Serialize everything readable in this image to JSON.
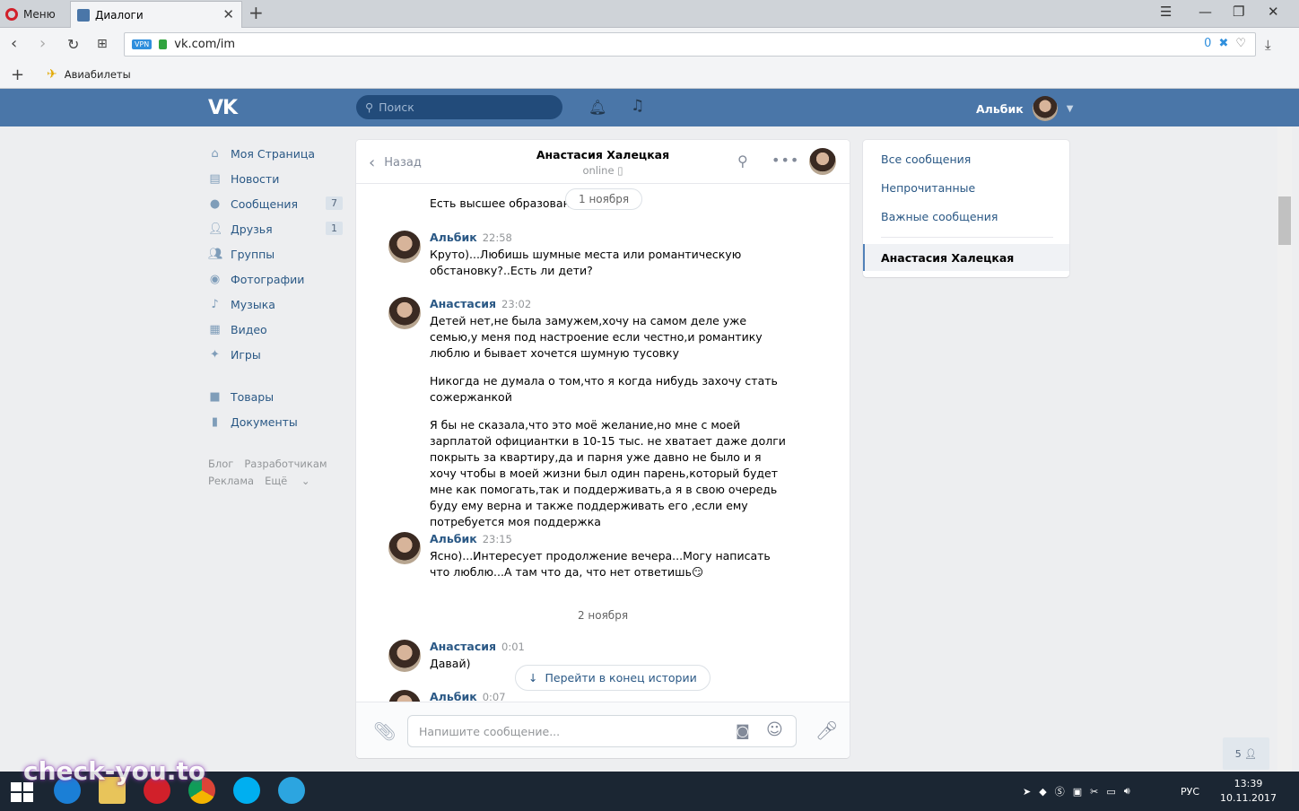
{
  "browser": {
    "menu_label": "Меню",
    "tab_title": "Диалоги",
    "url": "vk.com/im",
    "vpn_label": "VPN",
    "url_badge_count": "0",
    "bookmark_label": "Авиабилеты"
  },
  "header": {
    "logo": "VK",
    "search_placeholder": "Поиск",
    "user_name": "Альбик"
  },
  "left_menu": {
    "items": [
      {
        "label": "Моя Страница",
        "icon": "home-icon"
      },
      {
        "label": "Новости",
        "icon": "news-icon"
      },
      {
        "label": "Сообщения",
        "icon": "messages-icon",
        "count": "7"
      },
      {
        "label": "Друзья",
        "icon": "friends-icon",
        "count": "1"
      },
      {
        "label": "Группы",
        "icon": "groups-icon"
      },
      {
        "label": "Фотографии",
        "icon": "camera-icon"
      },
      {
        "label": "Музыка",
        "icon": "music-icon"
      },
      {
        "label": "Видео",
        "icon": "video-icon"
      },
      {
        "label": "Игры",
        "icon": "games-icon"
      },
      {
        "label": "Товары",
        "icon": "bag-icon"
      },
      {
        "label": "Документы",
        "icon": "document-icon"
      }
    ],
    "footer": [
      "Блог",
      "Разработчикам",
      "Реклама",
      "Ещё"
    ]
  },
  "chat": {
    "back_label": "Назад",
    "title": "Анастасия Халецкая",
    "status": "online",
    "date_pill": "1 ноября",
    "top_partial_text": "Есть высшее образовани",
    "messages": [
      {
        "author": "Альбик",
        "time": "22:58",
        "paragraphs": [
          "Круто)...Любишь шумные места или романтическую обстановку?..Есть ли дети?"
        ]
      },
      {
        "author": "Анастасия",
        "time": "23:02",
        "paragraphs": [
          "Детей нет,не была замужем,хочу на самом деле уже семью,у меня под настроение если честно,и романтику люблю и бывает хочется шумную тусовку",
          "Никогда не думала о том,что я когда нибудь захочу стать сожержанкой",
          "Я бы не сказала,что это моё желание,но мне с моей зарплатой официантки в 10-15 тыс. не хватает даже долги покрыть за квартиру,да и парня уже давно не было и я хочу чтобы в моей жизни был один парень,который будет мне как помогать,так и поддерживать,а я в свою очередь буду ему верна и также поддерживать его ,если ему потребуется моя поддержка"
        ]
      },
      {
        "author": "Альбик",
        "time": "23:15",
        "paragraphs": [
          "Ясно)...Интересует продолжение вечера...Могу написать что люблю...А там что да, что нет ответишь😏"
        ]
      }
    ],
    "date_divider": "2 ноября",
    "late_messages": [
      {
        "author": "Анастасия",
        "time": "0:01",
        "text": "Давай)"
      },
      {
        "author": "Альбик",
        "time": "0:07",
        "text": ""
      }
    ],
    "scroll_button": "Перейти в конец истории",
    "input_placeholder": "Напишите сообщение..."
  },
  "right_panel": {
    "items": [
      "Все сообщения",
      "Непрочитанные",
      "Важные сообщения"
    ],
    "active": "Анастасия Халецкая"
  },
  "online_counter": "5",
  "taskbar": {
    "language": "РУС",
    "time": "13:39",
    "date": "10.11.2017"
  },
  "watermark": "check-you.to",
  "colors": {
    "vk_blue": "#4a76a8",
    "link": "#2a5885",
    "background": "#edeef0"
  }
}
